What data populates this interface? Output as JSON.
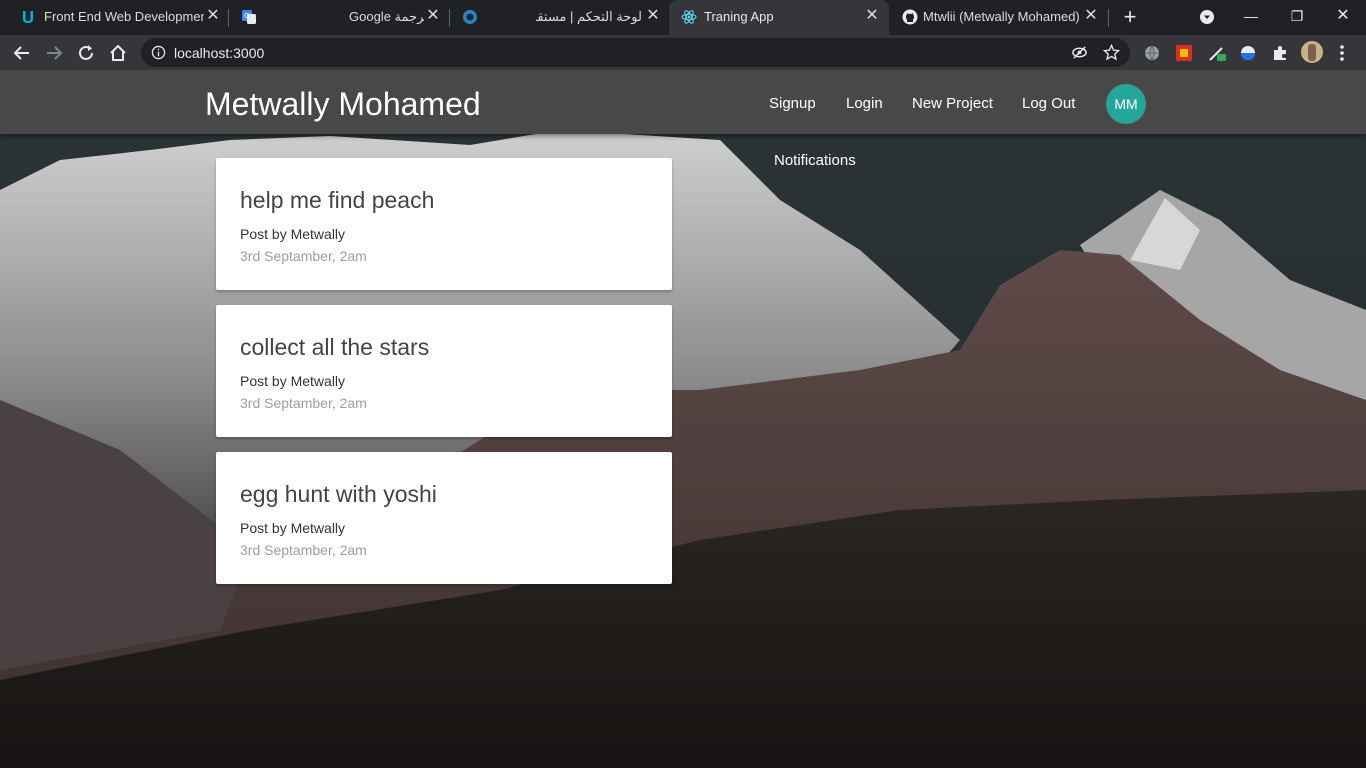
{
  "browser": {
    "tabs": [
      {
        "title": "Front End Web Development",
        "icon": "udacity-icon"
      },
      {
        "title": "",
        "icon": "google-translate-icon"
      },
      {
        "title": "Google ترجمة",
        "icon": ""
      },
      {
        "title": "لوحة التحكم | مستقل",
        "icon": "mostaql-icon"
      },
      {
        "title": "Traning App",
        "icon": "react-icon"
      },
      {
        "title": "Mtwlii (Metwally Mohamed)",
        "icon": "github-icon"
      }
    ],
    "url": "localhost:3000"
  },
  "app": {
    "brand": "Metwally Mohamed",
    "nav": {
      "signup": "Signup",
      "login": "Login",
      "new_project": "New Project",
      "logout": "Log Out"
    },
    "avatar_initials": "MM",
    "notifications_label": "Notifications",
    "accent_color": "#26a69a"
  },
  "projects": [
    {
      "title": "help me find peach",
      "author": "Post by Metwally",
      "date": "3rd Septamber, 2am"
    },
    {
      "title": "collect all the stars",
      "author": "Post by Metwally",
      "date": "3rd Septamber, 2am"
    },
    {
      "title": "egg hunt with yoshi",
      "author": "Post by Metwally",
      "date": "3rd Septamber, 2am"
    }
  ]
}
